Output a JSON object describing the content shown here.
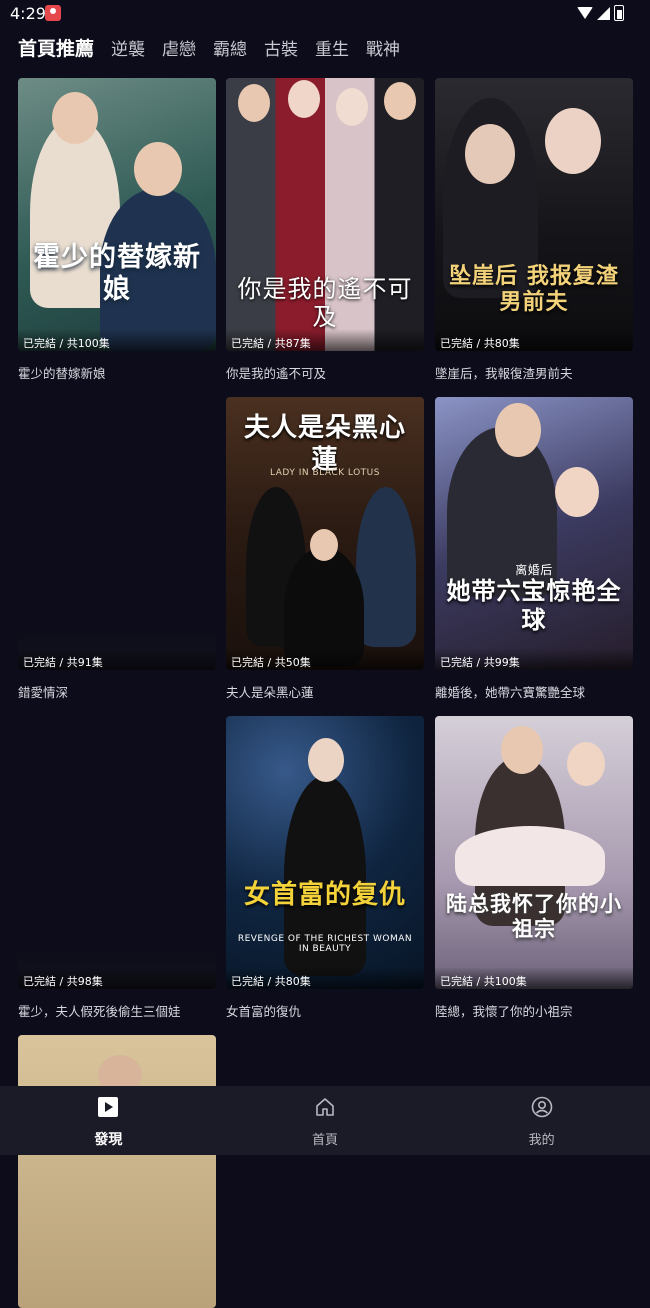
{
  "status_bar": {
    "time": "4:29"
  },
  "tabs": [
    "首頁推薦",
    "逆襲",
    "虐戀",
    "霸總",
    "古裝",
    "重生",
    "戰神"
  ],
  "cards": [
    {
      "title": "霍少的替嫁新娘",
      "badge": "已完結 / 共100集",
      "poster_text": "霍少的替嫁新娘",
      "poster_caption": "",
      "bg": "#2f5a54"
    },
    {
      "title": "你是我的遙不可及",
      "badge": "已完結 / 共87集",
      "poster_text": "你是我的遙不可及",
      "poster_caption": "",
      "bg": "#7a1f2b"
    },
    {
      "title": "墜崖后，我報復渣男前夫",
      "badge": "已完結 / 共80集",
      "poster_text": "坠崖后 我报复渣男前夫",
      "poster_caption": "",
      "bg": "#1b1a22"
    },
    {
      "title": "錯愛情深",
      "badge": "已完結 / 共91集",
      "poster_text": "",
      "poster_caption": "",
      "bg": "#0c0c1a"
    },
    {
      "title": "夫人是朵黑心蓮",
      "badge": "已完結 / 共50集",
      "poster_text": "夫人是朵黑心蓮",
      "poster_caption": "LADY IN BLACK LOTUS",
      "bg": "#3a2418"
    },
    {
      "title": "離婚後，她帶六寶驚艷全球",
      "badge": "已完結 / 共99集",
      "poster_text": "她带六宝惊艳全球",
      "poster_caption": "离婚后",
      "bg": "#3b3a60"
    },
    {
      "title": "霍少，夫人假死後偷生三個娃",
      "badge": "已完結 / 共98集",
      "poster_text": "",
      "poster_caption": "",
      "bg": "#0c0c1a"
    },
    {
      "title": "女首富的復仇",
      "badge": "已完結 / 共80集",
      "poster_text": "女首富的复仇",
      "poster_caption": "REVENGE OF THE RICHEST WOMAN IN BEAUTY",
      "bg": "#0f2540"
    },
    {
      "title": "陸總，我懷了你的小祖宗",
      "badge": "已完結 / 共100集",
      "poster_text": "陆总我怀了你的小祖宗",
      "poster_caption": "",
      "bg": "#a89ab0"
    },
    {
      "title": "",
      "badge": "",
      "poster_text": "",
      "poster_caption": "",
      "bg": "#c9b38c"
    }
  ],
  "bottom_nav": [
    {
      "label": "發現",
      "icon": "play-square-icon",
      "active": true
    },
    {
      "label": "首頁",
      "icon": "home-icon",
      "active": false
    },
    {
      "label": "我的",
      "icon": "profile-icon",
      "active": false
    }
  ]
}
